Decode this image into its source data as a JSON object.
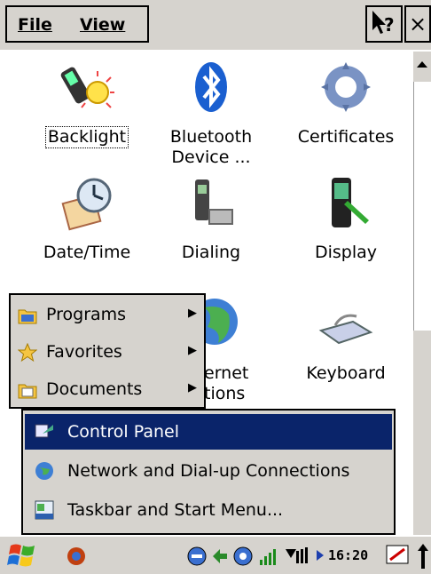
{
  "menubar": {
    "file": "File",
    "view": "View",
    "close": "×"
  },
  "items": [
    {
      "label": "Backlight",
      "icon": "backlight-icon"
    },
    {
      "label": "Bluetooth\nDevice ...",
      "icon": "bluetooth-icon"
    },
    {
      "label": "Certificates",
      "icon": "certificates-icon"
    },
    {
      "label": "Date/Time",
      "icon": "date-time-icon"
    },
    {
      "label": "Dialing",
      "icon": "dialing-icon"
    },
    {
      "label": "Display",
      "icon": "display-icon"
    },
    {
      "label": "ernet\ntions",
      "icon": "internet-icon"
    },
    {
      "label": "Keyboard",
      "icon": "keyboard-icon"
    }
  ],
  "start_menu": {
    "items": [
      {
        "label": "Programs",
        "accel": "P",
        "icon": "programs-folder-icon",
        "has_submenu": true
      },
      {
        "label": "Favorites",
        "accel": "a",
        "icon": "star-icon",
        "has_submenu": true
      },
      {
        "label": "Documents",
        "accel": "D",
        "icon": "documents-folder-icon",
        "has_submenu": true
      }
    ]
  },
  "settings_menu": {
    "items": [
      {
        "label": "Control Panel",
        "accel": "C",
        "selected": true
      },
      {
        "label": "Network and Dial-up Connections",
        "accel": "N",
        "selected": false
      },
      {
        "label": "Taskbar and Start Menu...",
        "accel": "T",
        "selected": false
      }
    ]
  },
  "taskbar": {
    "time": "16:20"
  },
  "colors": {
    "chrome": "#d6d3ce",
    "selection": "#0a246a"
  }
}
